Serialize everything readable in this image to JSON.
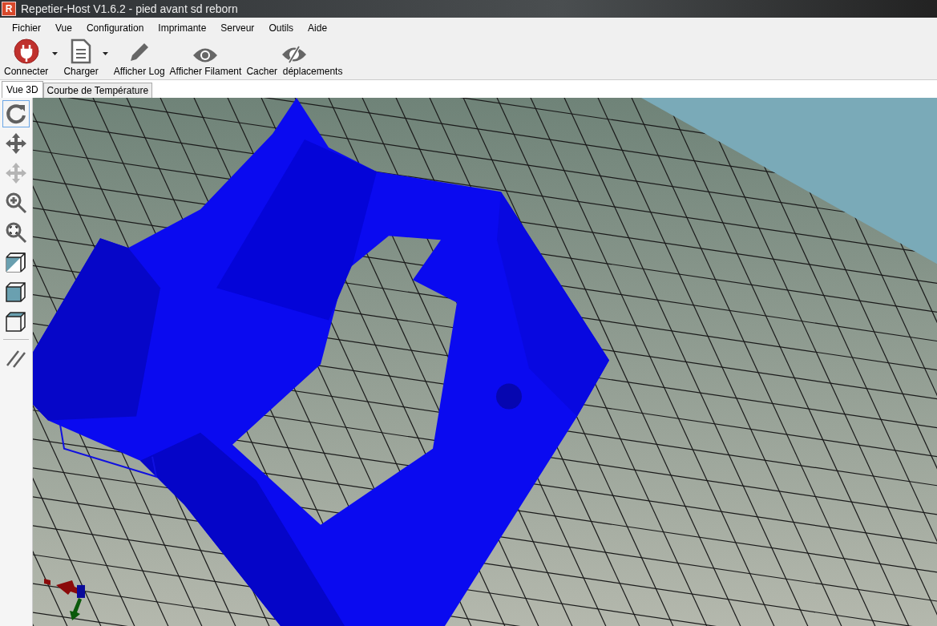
{
  "window": {
    "icon_letter": "R",
    "title": "Repetier-Host V1.6.2 - pied avant sd reborn"
  },
  "menu": [
    "Fichier",
    "Vue",
    "Configuration",
    "Imprimante",
    "Serveur",
    "Outils",
    "Aide"
  ],
  "toolbar": [
    {
      "kind": "connect",
      "label": "Connecter",
      "dropdown": true
    },
    {
      "kind": "document",
      "label": "Charger",
      "dropdown": true
    },
    {
      "kind": "pencil",
      "label": "Afficher Log",
      "dropdown": false
    },
    {
      "kind": "eye",
      "label": "Afficher Filament",
      "dropdown": false
    },
    {
      "kind": "eye-off",
      "label": "Cacher  déplacements",
      "dropdown": false
    }
  ],
  "tabs": [
    {
      "label": "Vue 3D",
      "selected": true
    },
    {
      "label": "Courbe de Température",
      "selected": false
    }
  ],
  "view_tools": [
    {
      "kind": "rotate",
      "selected": true,
      "disabled": false
    },
    {
      "kind": "move",
      "selected": false,
      "disabled": false
    },
    {
      "kind": "move-object",
      "selected": false,
      "disabled": true
    },
    {
      "kind": "zoom",
      "selected": false,
      "disabled": false
    },
    {
      "kind": "fit",
      "selected": false,
      "disabled": false
    },
    {
      "kind": "iso",
      "selected": false,
      "disabled": false
    },
    {
      "kind": "front",
      "selected": false,
      "disabled": false
    },
    {
      "kind": "top",
      "selected": false,
      "disabled": false
    },
    {
      "kind": "parallel",
      "selected": false,
      "disabled": false
    }
  ]
}
